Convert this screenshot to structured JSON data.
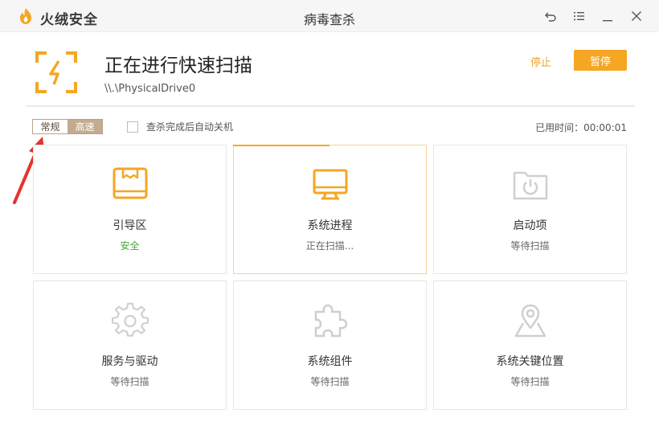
{
  "app": {
    "brand": "火绒安全",
    "window_title": "病毒查杀",
    "brand_color": "#f5a623"
  },
  "scan": {
    "title": "正在进行快速扫描",
    "path": "\\\\.\\PhysicalDrive0",
    "stop_label": "停止",
    "pause_label": "暂停"
  },
  "options": {
    "mode_normal": "常规",
    "mode_fast": "高速",
    "auto_shutdown_label": "查杀完成后自动关机",
    "auto_shutdown_checked": false,
    "elapsed_label": "已用时间：",
    "elapsed_value": "00:00:01"
  },
  "cards": [
    {
      "title": "引导区",
      "status": "安全",
      "icon": "boot-sector-icon"
    },
    {
      "title": "系统进程",
      "status": "正在扫描...",
      "icon": "monitor-icon",
      "progress": 0.5
    },
    {
      "title": "启动项",
      "status": "等待扫描",
      "icon": "startup-folder-icon"
    },
    {
      "title": "服务与驱动",
      "status": "等待扫描",
      "icon": "gear-icon"
    },
    {
      "title": "系统组件",
      "status": "等待扫描",
      "icon": "puzzle-icon"
    },
    {
      "title": "系统关键位置",
      "status": "等待扫描",
      "icon": "location-pin-icon"
    }
  ]
}
